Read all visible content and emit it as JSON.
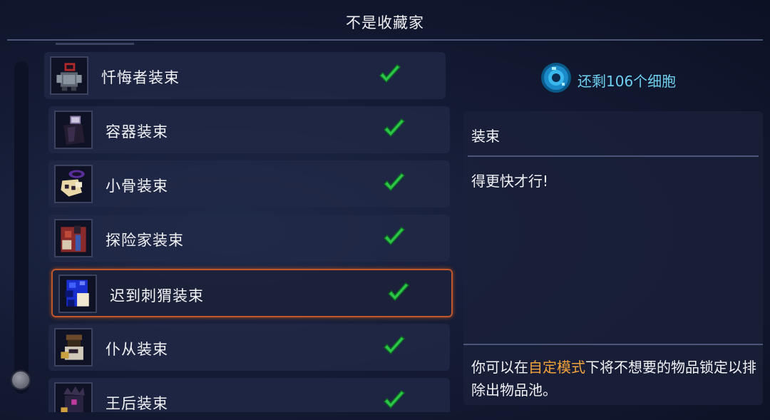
{
  "header": {
    "title": "不是收藏家"
  },
  "items": [
    {
      "label": "忏悔者装束",
      "icon": "penitent-outfit-icon",
      "checked": true
    },
    {
      "label": "容器装束",
      "icon": "vessel-outfit-icon",
      "checked": true
    },
    {
      "label": "小骨装束",
      "icon": "little-bone-outfit-icon",
      "checked": true
    },
    {
      "label": "探险家装束",
      "icon": "explorer-outfit-icon",
      "checked": true
    },
    {
      "label": "迟到刺猬装束",
      "icon": "late-hedgehog-outfit-icon",
      "checked": true,
      "selected": true
    },
    {
      "label": "仆从装束",
      "icon": "servant-outfit-icon",
      "checked": true
    },
    {
      "label": "王后装束",
      "icon": "queen-outfit-icon",
      "checked": true
    }
  ],
  "cells": {
    "text": "还剩106个细胞",
    "icon": "cell-icon"
  },
  "detail": {
    "category": "装束",
    "description": "得更快才行!",
    "note_prefix": "你可以在",
    "note_highlight": "自定模式",
    "note_suffix": "下将不想要的物品锁定以排除出物品池。"
  },
  "colors": {
    "highlight": "#f2a23a",
    "cells_text": "#6fd0f0",
    "check": "#2ec44a",
    "selected_border": "#c0562c"
  }
}
